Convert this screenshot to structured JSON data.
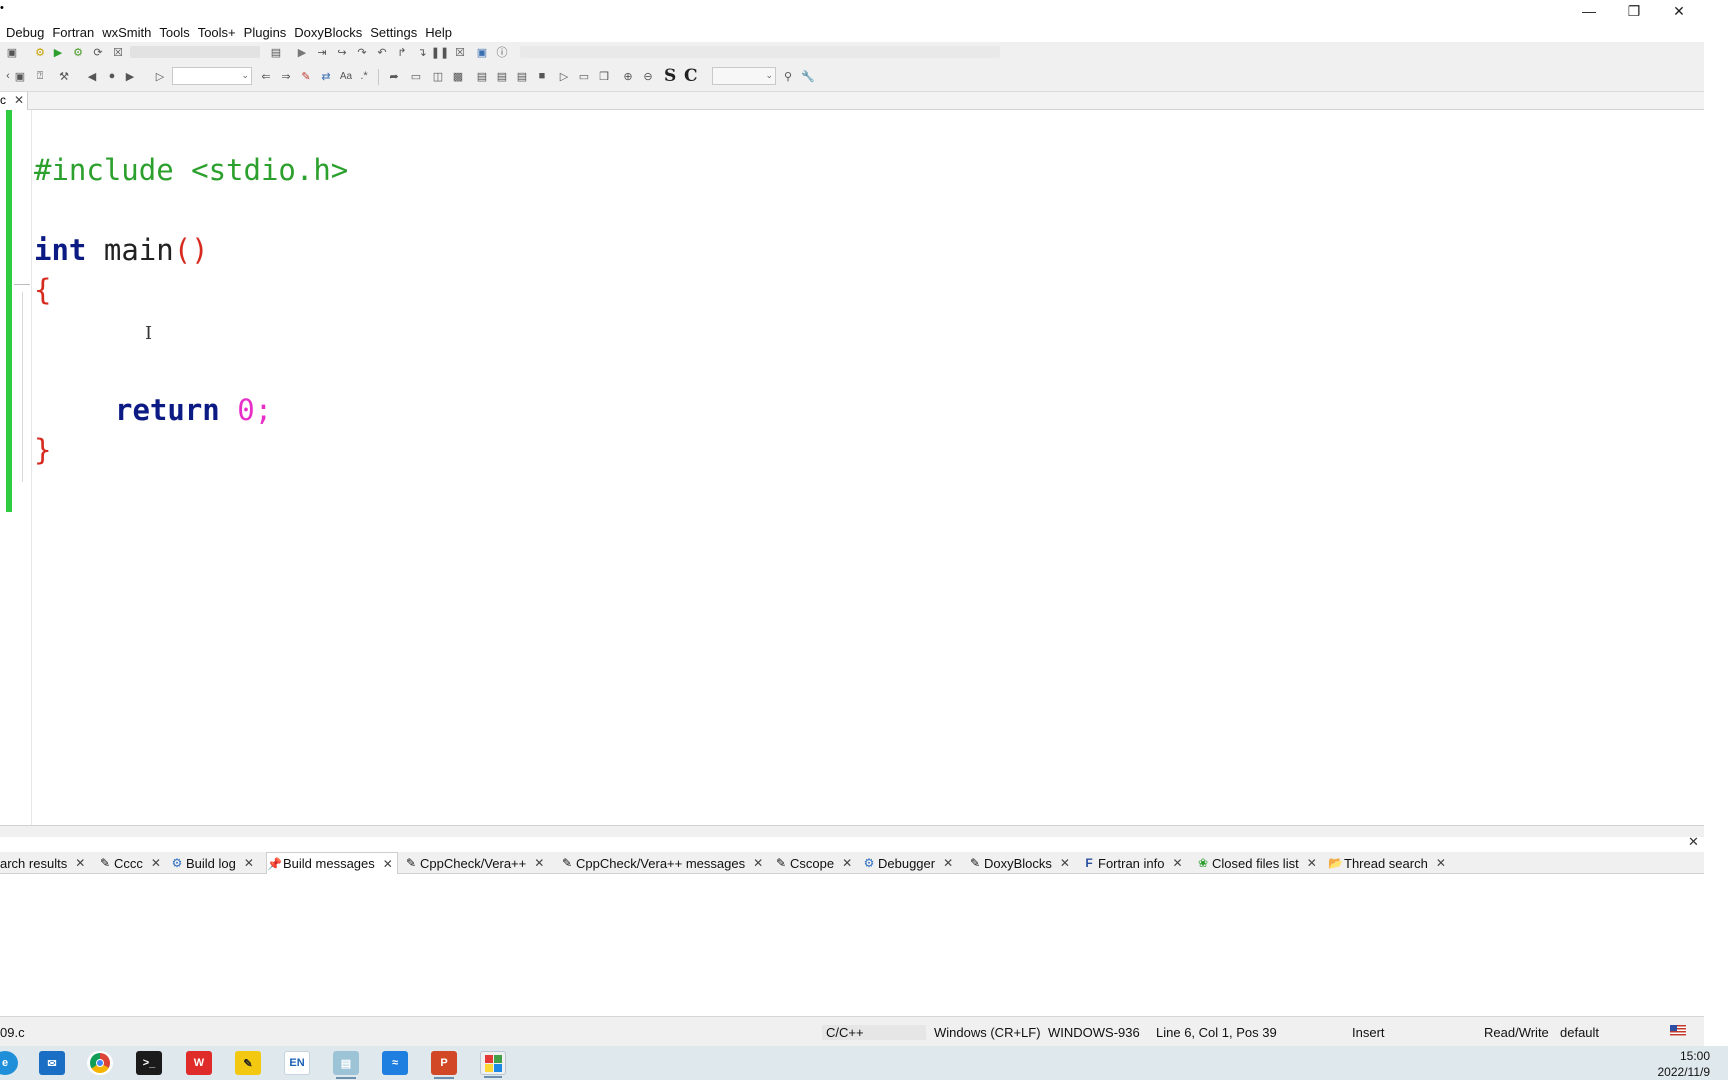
{
  "menubar": {
    "items": [
      "Debug",
      "Fortran",
      "wxSmith",
      "Tools",
      "Tools+",
      "Plugins",
      "DoxyBlocks",
      "Settings",
      "Help"
    ]
  },
  "editor_tab": {
    "label": "c"
  },
  "code": {
    "line1": "#include <stdio.h>",
    "line3_kw": "int",
    "line3_id": "main",
    "line3_parens": "()",
    "open_brace": "{",
    "return_kw": "return",
    "return_num": "0",
    "return_semi": ";",
    "close_brace": "}"
  },
  "bottom_tabs": [
    {
      "label": "arch results",
      "icon": "none"
    },
    {
      "label": "Cccc",
      "icon": "pencil-icon"
    },
    {
      "label": "Build log",
      "icon": "gear-icon"
    },
    {
      "label": "Build messages",
      "icon": "pin-icon"
    },
    {
      "label": "CppCheck/Vera++",
      "icon": "pencil-icon"
    },
    {
      "label": "CppCheck/Vera++ messages",
      "icon": "pencil-icon"
    },
    {
      "label": "Cscope",
      "icon": "pencil-icon"
    },
    {
      "label": "Debugger",
      "icon": "gear-icon"
    },
    {
      "label": "DoxyBlocks",
      "icon": "pencil-icon"
    },
    {
      "label": "Fortran info",
      "icon": "fortran-icon"
    },
    {
      "label": "Closed files list",
      "icon": "leaf-icon"
    },
    {
      "label": "Thread search",
      "icon": "search-folder-icon"
    }
  ],
  "statusbar": {
    "file": "09.c",
    "language": "C/C++",
    "line_endings": "Windows (CR+LF)",
    "encoding": "WINDOWS-936",
    "position": "Line 6, Col 1, Pos 39",
    "mode": "Insert",
    "access": "Read/Write",
    "profile": "default"
  },
  "toolbar": {
    "letter_s": "S",
    "letter_c": "C"
  },
  "taskbar": {
    "ime_label": "EN",
    "time": "15:00",
    "date": "2022/11/9"
  },
  "colors": {
    "preprocessor": "#2ca02c",
    "keyword": "#0c1b84",
    "brace": "#d62a1e",
    "number": "#e830c8",
    "change_bar": "#2ecc40"
  }
}
